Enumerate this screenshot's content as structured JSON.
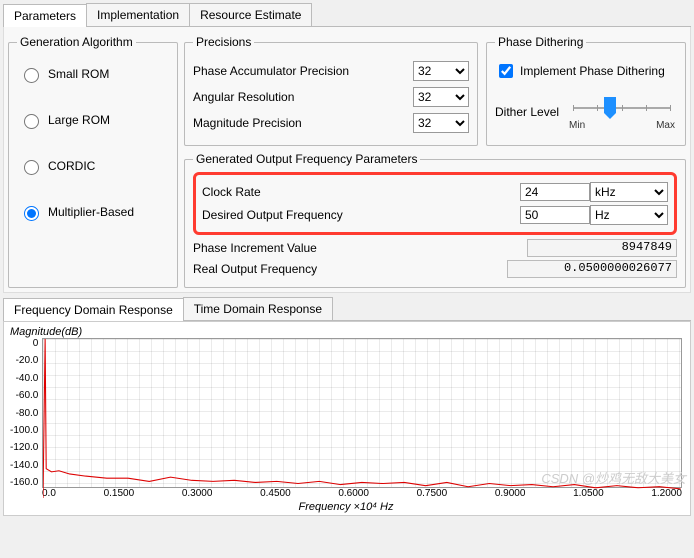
{
  "tabs": {
    "parameters": "Parameters",
    "implementation": "Implementation",
    "resource": "Resource Estimate"
  },
  "gen_alg": {
    "legend": "Generation Algorithm",
    "small_rom": "Small ROM",
    "large_rom": "Large ROM",
    "cordic": "CORDIC",
    "multiplier": "Multiplier-Based",
    "selected": "multiplier"
  },
  "precisions": {
    "legend": "Precisions",
    "phase_acc_label": "Phase Accumulator Precision",
    "phase_acc_value": "32",
    "ang_res_label": "Angular Resolution",
    "ang_res_value": "32",
    "mag_prec_label": "Magnitude Precision",
    "mag_prec_value": "32"
  },
  "dithering": {
    "legend": "Phase Dithering",
    "impl_label": "Implement Phase Dithering",
    "impl_checked": true,
    "level_label": "Dither Level",
    "min": "Min",
    "max": "Max"
  },
  "genout": {
    "legend": "Generated Output Frequency Parameters",
    "clock_label": "Clock Rate",
    "clock_value": "24",
    "clock_unit": "kHz",
    "desired_label": "Desired Output Frequency",
    "desired_value": "50",
    "desired_unit": "Hz",
    "phase_inc_label": "Phase Increment Value",
    "phase_inc_value": "8947849",
    "real_out_label": "Real Output Frequency",
    "real_out_value": "0.0500000026077"
  },
  "resp_tabs": {
    "freq": "Frequency Domain Response",
    "time": "Time Domain Response"
  },
  "chart": {
    "ylabel": "Magnitude(dB)",
    "xlabel": "Frequency ×10⁴   Hz",
    "yticks": [
      "0",
      "-20.0",
      "-40.0",
      "-60.0",
      "-80.0",
      "-100.0",
      "-120.0",
      "-140.0",
      "-160.0"
    ],
    "xticks": [
      "0.0",
      "0.1500",
      "0.3000",
      "0.4500",
      "0.6000",
      "0.7500",
      "0.9000",
      "1.0500",
      "1.2000"
    ]
  },
  "watermark": "CSDN @炒鸡无敌大美女",
  "chart_data": {
    "type": "line",
    "title": "Frequency Domain Response",
    "xlabel": "Frequency ×10^4 Hz",
    "ylabel": "Magnitude (dB)",
    "xlim": [
      0.0,
      1.2
    ],
    "ylim": [
      -160,
      0
    ],
    "note": "Single narrow spectral peak near x≈0.005 reaching ~0 dB; noise floor starts ~-130 dB and decays with jitter toward ~-150 dB at x=1.2",
    "series": [
      {
        "name": "Magnitude",
        "x": [
          0.0,
          0.005,
          0.01,
          0.05,
          0.1,
          0.2,
          0.3,
          0.4,
          0.5,
          0.6,
          0.7,
          0.8,
          0.9,
          1.0,
          1.1,
          1.2
        ],
        "y": [
          -160,
          0,
          -130,
          -135,
          -138,
          -140,
          -142,
          -143,
          -144,
          -145,
          -146,
          -147,
          -148,
          -148,
          -149,
          -150
        ]
      }
    ]
  }
}
